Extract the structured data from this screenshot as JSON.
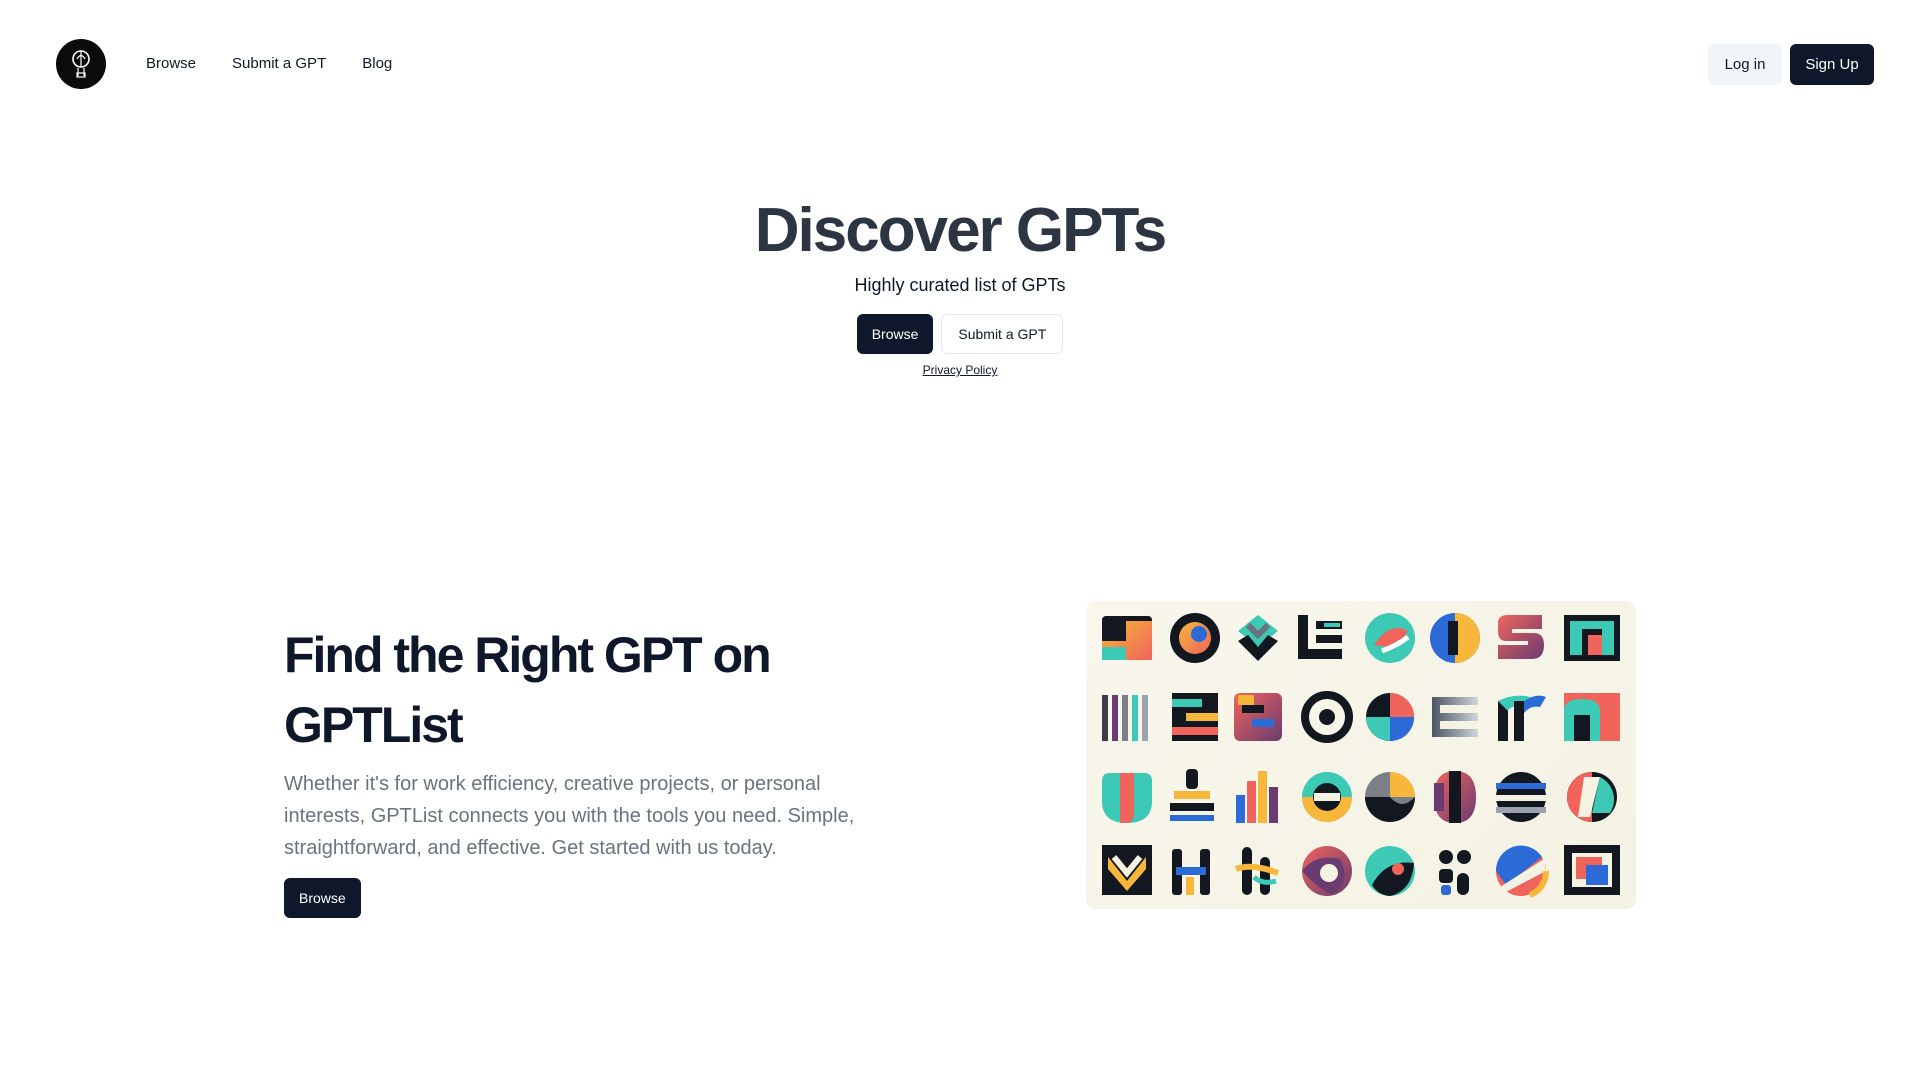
{
  "header": {
    "logo_icon": "balloon-logo-icon",
    "nav": [
      "Browse",
      "Submit a GPT",
      "Blog"
    ],
    "login_label": "Log in",
    "signup_label": "Sign Up"
  },
  "hero": {
    "title": "Discover GPTs",
    "subtitle": "Highly curated list of GPTs",
    "browse_label": "Browse",
    "submit_label": "Submit a GPT",
    "privacy_label": "Privacy Policy"
  },
  "feature": {
    "title": "Find the Right GPT on GPTList",
    "description": "Whether it's for work efficiency, creative projects, or personal interests, GPTList connects you with the tools you need. Simple, straightforward, and effective. Get started with us today.",
    "browse_label": "Browse"
  },
  "icon_grid": {
    "rows": 4,
    "cols": 8,
    "colors": {
      "dark": "#13171f",
      "orange": "#f08a3e",
      "teal": "#3cc9b5",
      "coral": "#f0645c",
      "blue": "#2c6ad8",
      "yellow": "#f6b73a",
      "purple": "#6a3b70",
      "gray": "#7b7f86"
    }
  },
  "colors": {
    "primary": "#0f172a",
    "muted_text": "#6b7280",
    "secondary_bg": "#f1f5f9"
  }
}
